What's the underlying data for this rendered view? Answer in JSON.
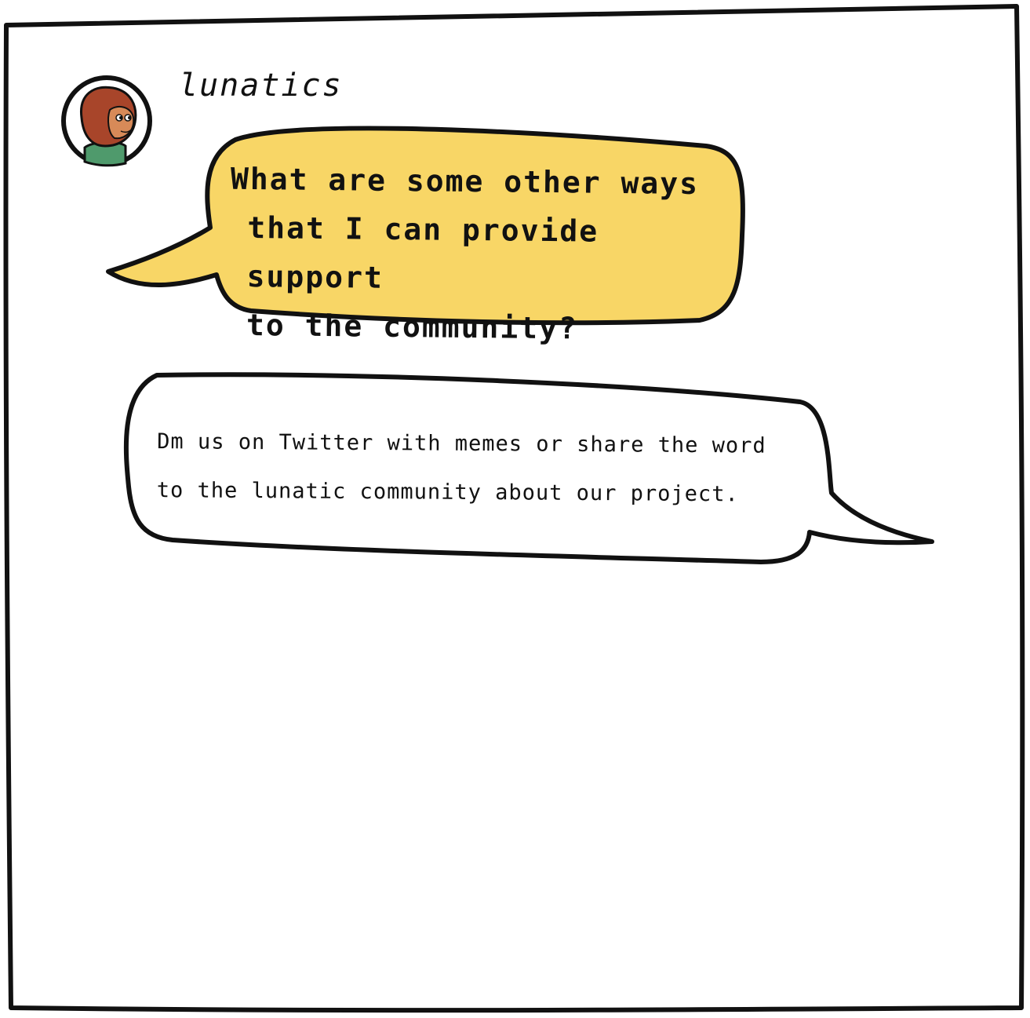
{
  "post": {
    "username": "lunatics",
    "avatar": "monkey-puppet-avatar",
    "question_lines": [
      "What are some other ways",
      "that I can provide support",
      "to the community?"
    ],
    "answer_lines": [
      "Dm us on Twitter with memes or share the word",
      "to the lunatic community about our project."
    ]
  },
  "colors": {
    "question_bubble": "#f8d666",
    "answer_bubble": "#ffffff",
    "outline": "#111111",
    "avatar_fur": "#a8452a",
    "avatar_face": "#d78a58",
    "avatar_shirt": "#4f9a6c"
  }
}
